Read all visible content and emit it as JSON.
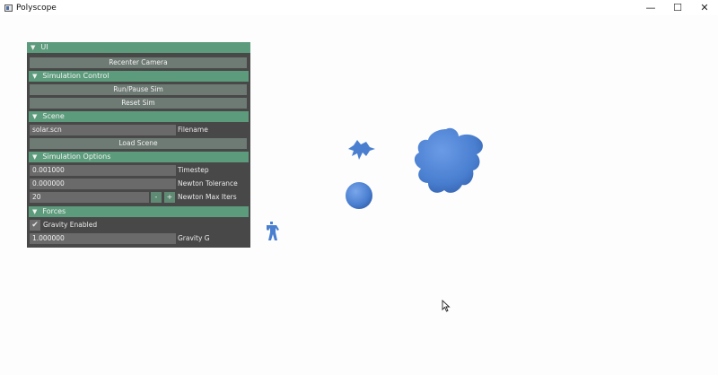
{
  "window": {
    "title": "Polyscope",
    "minimize_glyph": "—",
    "maximize_glyph": "☐",
    "close_glyph": "✕"
  },
  "ui": {
    "header": "UI",
    "recenter_label": "Recenter Camera",
    "simulation_control": {
      "header": "Simulation Control",
      "run_pause_label": "Run/Pause Sim",
      "reset_label": "Reset Sim"
    },
    "scene": {
      "header": "Scene",
      "filename_value": "solar.scn",
      "filename_label": "Filename",
      "load_label": "Load Scene"
    },
    "simulation_options": {
      "header": "Simulation Options",
      "timestep_value": "0.001000",
      "timestep_label": "Timestep",
      "newton_tolerance_value": "0.000000",
      "newton_tolerance_label": "Newton Tolerance",
      "newton_max_iters_value": "20",
      "newton_max_iters_label": "Newton Max Iters",
      "minus_label": "-",
      "plus_label": "+"
    },
    "forces": {
      "header": "Forces",
      "gravity_enabled_label": "Gravity Enabled",
      "gravity_enabled_checked": true,
      "gravity_g_value": "1.000000",
      "gravity_g_label": "Gravity G"
    }
  },
  "colors": {
    "header_green": "#5c9b7b",
    "panel_bg": "#484848",
    "mesh_blue": "#4a7fd0"
  },
  "icons": [
    "app-icon",
    "minimize-icon",
    "maximize-icon",
    "close-icon",
    "collapse-arrow-icon",
    "checkmark-icon",
    "mouse-cursor-icon"
  ]
}
